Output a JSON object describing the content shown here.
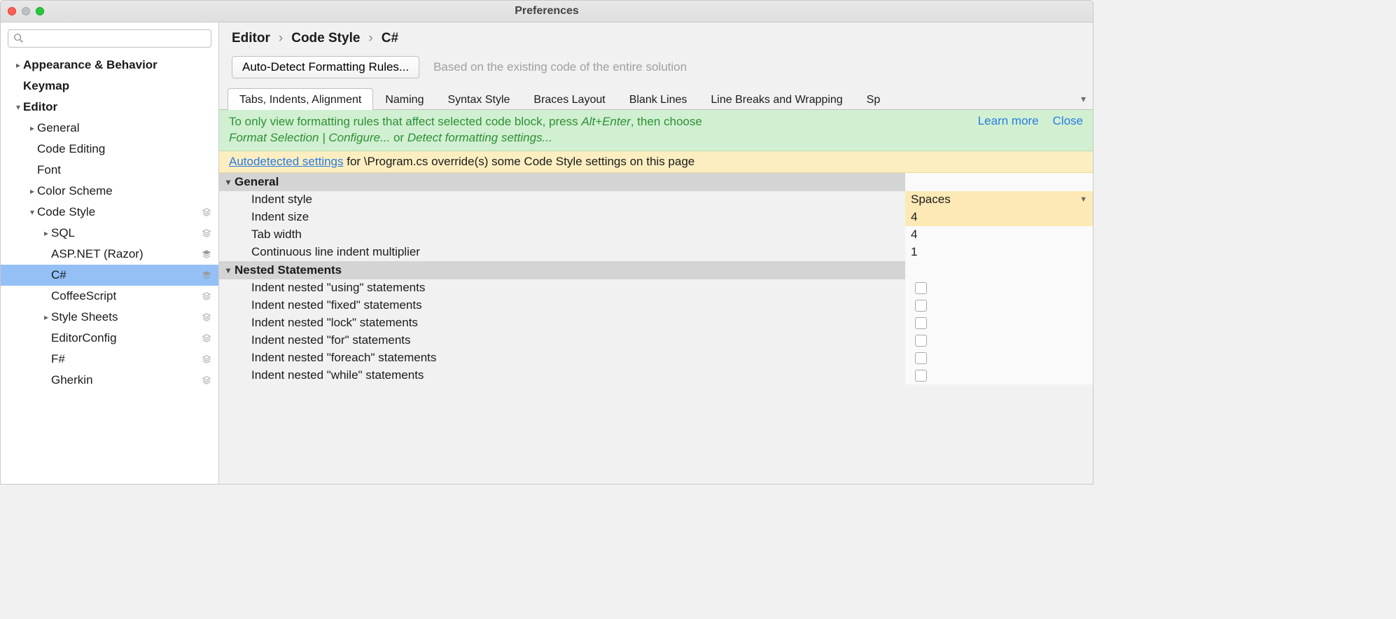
{
  "window": {
    "title": "Preferences"
  },
  "sidebar": {
    "search_placeholder": "",
    "items": [
      {
        "label": "Appearance & Behavior",
        "bold": true,
        "arrow": "right",
        "indent": 0
      },
      {
        "label": "Keymap",
        "bold": true,
        "arrow": "",
        "indent": 0
      },
      {
        "label": "Editor",
        "bold": true,
        "arrow": "down",
        "indent": 0
      },
      {
        "label": "General",
        "arrow": "right",
        "indent": 1
      },
      {
        "label": "Code Editing",
        "arrow": "",
        "indent": 1
      },
      {
        "label": "Font",
        "arrow": "",
        "indent": 1
      },
      {
        "label": "Color Scheme",
        "arrow": "right",
        "indent": 1
      },
      {
        "label": "Code Style",
        "arrow": "down",
        "indent": 1,
        "badge": "layers-outline"
      },
      {
        "label": "SQL",
        "arrow": "right",
        "indent": 2,
        "badge": "layers-outline"
      },
      {
        "label": "ASP.NET (Razor)",
        "arrow": "",
        "indent": 2,
        "badge": "layers-solid"
      },
      {
        "label": "C#",
        "arrow": "",
        "indent": 2,
        "selected": true,
        "badge": "layers-solid"
      },
      {
        "label": "CoffeeScript",
        "arrow": "",
        "indent": 2,
        "badge": "layers-outline"
      },
      {
        "label": "Style Sheets",
        "arrow": "right",
        "indent": 2,
        "badge": "layers-outline"
      },
      {
        "label": "EditorConfig",
        "arrow": "",
        "indent": 2,
        "badge": "layers-outline"
      },
      {
        "label": "F#",
        "arrow": "",
        "indent": 2,
        "badge": "layers-outline"
      },
      {
        "label": "Gherkin",
        "arrow": "",
        "indent": 2,
        "badge": "layers-outline"
      }
    ]
  },
  "main": {
    "breadcrumb": [
      "Editor",
      "Code Style",
      "C#"
    ],
    "action_button": "Auto-Detect Formatting Rules...",
    "action_hint": "Based on the existing code of the entire solution",
    "tabs": [
      "Tabs, Indents, Alignment",
      "Naming",
      "Syntax Style",
      "Braces Layout",
      "Blank Lines",
      "Line Breaks and Wrapping",
      "Sp"
    ],
    "active_tab": 0,
    "tip_green": {
      "text_a": "To only view formatting rules that affect selected code block, press ",
      "shortcut": "Alt+Enter",
      "text_b": ", then choose ",
      "choice_a": "Format Selection | Configure...",
      "text_c": " or ",
      "choice_b": "Detect formatting settings...",
      "learn_more": "Learn more",
      "close": "Close"
    },
    "tip_yellow": {
      "link": "Autodetected settings",
      "text": " for \\Program.cs override(s) some Code Style settings on this page"
    },
    "sections": [
      {
        "name": "General",
        "rows": [
          {
            "label": "Indent style",
            "value": "Spaces",
            "type": "dropdown",
            "highlight": true
          },
          {
            "label": "Indent size",
            "value": "4",
            "type": "text",
            "highlight": true
          },
          {
            "label": "Tab width",
            "value": "4",
            "type": "text"
          },
          {
            "label": "Continuous line indent multiplier",
            "value": "1",
            "type": "text"
          }
        ]
      },
      {
        "name": "Nested Statements",
        "rows": [
          {
            "label": "Indent nested \"using\" statements",
            "type": "checkbox",
            "checked": false
          },
          {
            "label": "Indent nested \"fixed\" statements",
            "type": "checkbox",
            "checked": false
          },
          {
            "label": "Indent nested \"lock\" statements",
            "type": "checkbox",
            "checked": false
          },
          {
            "label": "Indent nested \"for\" statements",
            "type": "checkbox",
            "checked": false
          },
          {
            "label": "Indent nested \"foreach\" statements",
            "type": "checkbox",
            "checked": false
          },
          {
            "label": "Indent nested \"while\" statements",
            "type": "checkbox",
            "checked": false
          }
        ]
      }
    ]
  }
}
